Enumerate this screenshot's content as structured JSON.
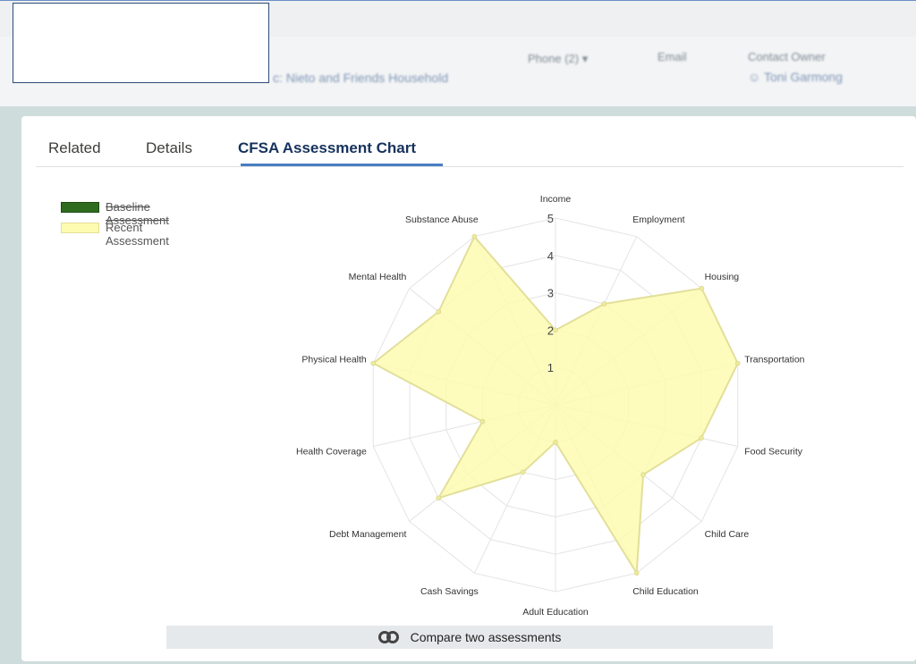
{
  "header": {
    "household": "c: Nieto and Friends Household",
    "phone_label": "Phone (2)",
    "email_label": "Email",
    "contact_owner_label": "Contact Owner",
    "contact_owner_value": "Toni Garmong"
  },
  "tabs": [
    {
      "label": "Related"
    },
    {
      "label": "Details"
    },
    {
      "label": "CFSA Assessment Chart"
    }
  ],
  "legend": [
    {
      "label": "Baseline Assessment",
      "color": "#2e6b1e",
      "hidden": true
    },
    {
      "label": "Recent Assessment",
      "color": "#fdfbb0",
      "hidden": false
    }
  ],
  "chart_data": {
    "type": "radar",
    "r_max": 5,
    "r_ticks": [
      "1",
      "2",
      "3",
      "4",
      "5"
    ],
    "categories": [
      "Income",
      "Employment",
      "Housing",
      "Transportation",
      "Food Security",
      "Child Care",
      "Child Education",
      "Adult Education",
      "Cash Savings",
      "Debt Management",
      "Health Coverage",
      "Physical Health",
      "Mental Health",
      "Substance Abuse"
    ],
    "series": [
      {
        "name": "Recent Assessment",
        "values": [
          2,
          3,
          5,
          5,
          4,
          3,
          5,
          1,
          2,
          4,
          2,
          5,
          4,
          5
        ],
        "fill": "#fdfbb0",
        "stroke": "#e3df9a"
      }
    ]
  },
  "compare_button": {
    "label": "Compare two assessments"
  }
}
